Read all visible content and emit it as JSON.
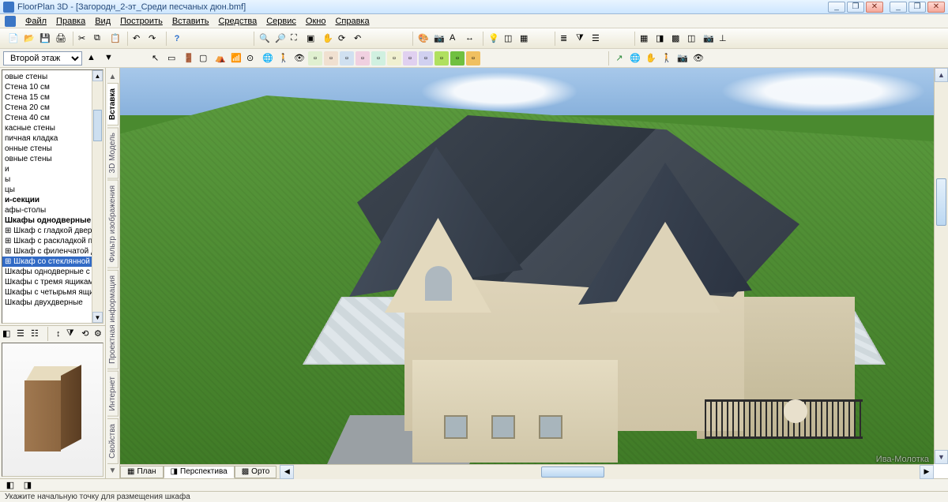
{
  "title": "FloorPlan 3D - [Загородн_2-эт_Среди песчаных дюн.bmf]",
  "window_buttons": {
    "min": "_",
    "max": "❐",
    "close": "✕",
    "doc_min": "_",
    "doc_max": "❐",
    "doc_close": "✕"
  },
  "menu": [
    "Файл",
    "Правка",
    "Вид",
    "Построить",
    "Вставить",
    "Средства",
    "Сервис",
    "Окно",
    "Справка"
  ],
  "floor_selector": {
    "value": "Второй этаж"
  },
  "tree": {
    "items": [
      {
        "t": "овые стены"
      },
      {
        "t": "Стена 10 см"
      },
      {
        "t": "Стена 15 см"
      },
      {
        "t": "Стена 20 см"
      },
      {
        "t": "Стена 40 см"
      },
      {
        "t": "касные стены"
      },
      {
        "t": "пичная кладка"
      },
      {
        "t": "онные стены"
      },
      {
        "t": "овные стены"
      },
      {
        "t": "и"
      },
      {
        "t": "ы"
      },
      {
        "t": "цы"
      },
      {
        "t": "и-секции",
        "bold": true
      },
      {
        "t": "афы-столы"
      },
      {
        "t": "Шкафы однодверные",
        "bold": true
      },
      {
        "t": "⊞ Шкаф с гладкой дверцей"
      },
      {
        "t": "⊞ Шкаф с раскладкой по стеклу"
      },
      {
        "t": "⊞ Шкаф с филенчатой дверцей"
      },
      {
        "t": "⊞ Шкаф со стеклянной дверцей",
        "sel": true
      },
      {
        "t": "Шкафы однодверные с ящиком"
      },
      {
        "t": "Шкафы с тремя ящиками"
      },
      {
        "t": "Шкафы с четырьмя ящиками"
      },
      {
        "t": "Шкафы двухдверные"
      }
    ]
  },
  "side_tabs": [
    "Вставка",
    "3D Модель",
    "Фильтр изображения",
    "Проектная информация",
    "Интернет",
    "Свойства"
  ],
  "side_tabs_active_index": 0,
  "view_tabs": {
    "plan": "План",
    "perspective": "Перспектива",
    "ortho": "Орто"
  },
  "view_tabs_active": "perspective",
  "status": "Укажите начальную точку для размещения шкафа",
  "watermark": "Ива-Молотка",
  "icons": {
    "new": "📄",
    "open": "📂",
    "save": "💾",
    "print": "🖨",
    "cut": "✂",
    "copy": "⧉",
    "paste": "📋",
    "undo": "↶",
    "redo": "↷",
    "help": "?",
    "zoom_in": "🔍",
    "zoom_out": "🔎",
    "zoom_win": "⛶",
    "zoom_fit": "▣",
    "pan": "✋",
    "refresh": "⟳",
    "wall": "▭",
    "door": "🚪",
    "window": "▢",
    "roof": "⛺",
    "stairs": "📶",
    "text": "A",
    "dim": "↔",
    "light": "💡",
    "camera": "📷",
    "3d": "◫",
    "render": "🎨",
    "layers": "≣",
    "grid": "▦",
    "snap": "⊙",
    "ortho_i": "⊥",
    "walk": "🚶",
    "orbit": "🌐",
    "look": "👁",
    "up": "▲",
    "down": "▼",
    "arrow": "↖",
    "tree_icon": "◧",
    "list_icon": "☰",
    "detail": "☷",
    "filter": "⧩",
    "plan_i": "▦",
    "persp_i": "◨",
    "ortho_tab": "▩"
  }
}
